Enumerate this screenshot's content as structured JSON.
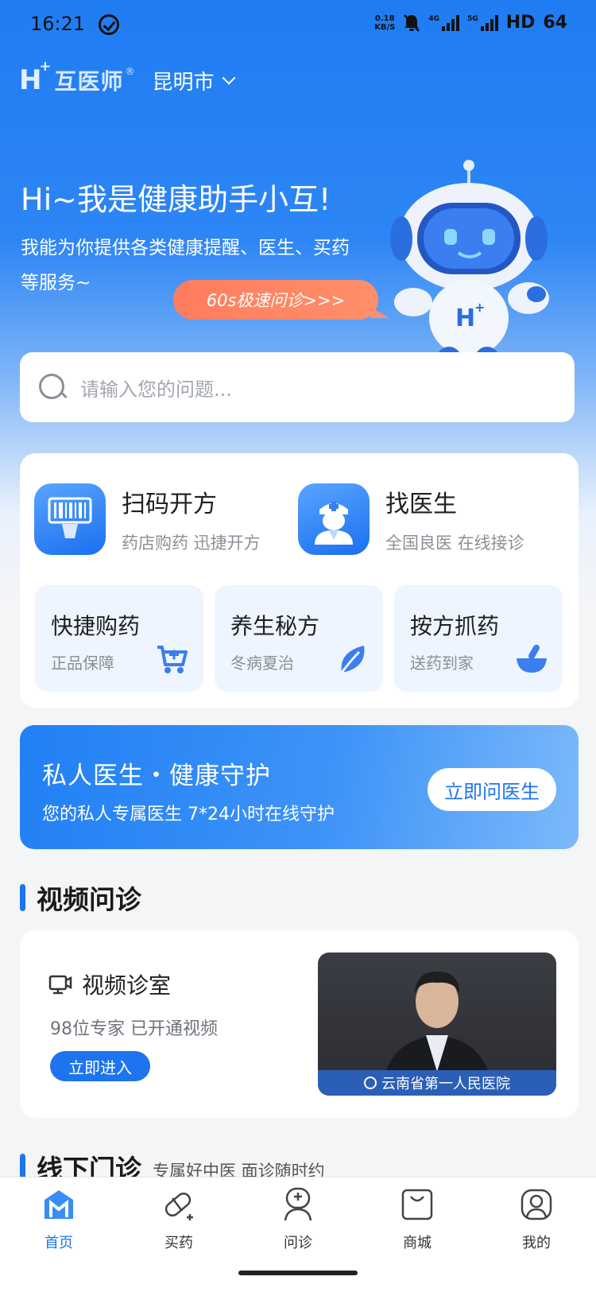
{
  "status_bar": {
    "time": "16:21",
    "net_speed_value": "0.18",
    "net_speed_unit": "KB/S",
    "sig1_label": "4G",
    "sig2_label": "5G",
    "hd": "HD",
    "battery": "64"
  },
  "header": {
    "logo_text": "互医师",
    "logo_reg": "®",
    "city": "昆明市"
  },
  "hero": {
    "title": "Hi~我是健康助手小互!",
    "desc": "我能为你提供各类健康提醒、医生、买药等服务~",
    "quick_consult": "60s极速问诊>>>"
  },
  "search": {
    "placeholder": "请输入您的问题..."
  },
  "services": {
    "scan": {
      "title": "扫码开方",
      "subtitle": "药店购药 迅捷开方"
    },
    "doctor": {
      "title": "找医生",
      "subtitle": "全国良医 在线接诊"
    },
    "mini": [
      {
        "title": "快捷购药",
        "subtitle": "正品保障",
        "icon": "cart-plus-icon"
      },
      {
        "title": "养生秘方",
        "subtitle": "冬病夏治",
        "icon": "leaf-icon"
      },
      {
        "title": "按方抓药",
        "subtitle": "送药到家",
        "icon": "mortar-pestle-icon"
      }
    ]
  },
  "private_doctor": {
    "title": "私人医生・健康守护",
    "subtitle": "您的私人专属医生 7*24小时在线守护",
    "button": "立即问医生"
  },
  "video_section": {
    "title": "视频问诊",
    "card_title": "视频诊室",
    "card_subtitle": "98位专家 已开通视频",
    "button": "立即进入",
    "hospital": "云南省第一人民医院"
  },
  "offline_section": {
    "title": "线下门诊",
    "subtitle": "专属好中医 面诊随时约"
  },
  "tabbar": [
    {
      "label": "首页",
      "active": true,
      "icon": "home-icon"
    },
    {
      "label": "买药",
      "active": false,
      "icon": "pill-icon"
    },
    {
      "label": "问诊",
      "active": false,
      "icon": "doctor-icon"
    },
    {
      "label": "商城",
      "active": false,
      "icon": "shopping-bag-icon"
    },
    {
      "label": "我的",
      "active": false,
      "icon": "profile-icon"
    }
  ],
  "colors": {
    "brand": "#1d74ee",
    "accent_orange": "#ff7c5e",
    "mini_bg": "#eef5ff"
  }
}
